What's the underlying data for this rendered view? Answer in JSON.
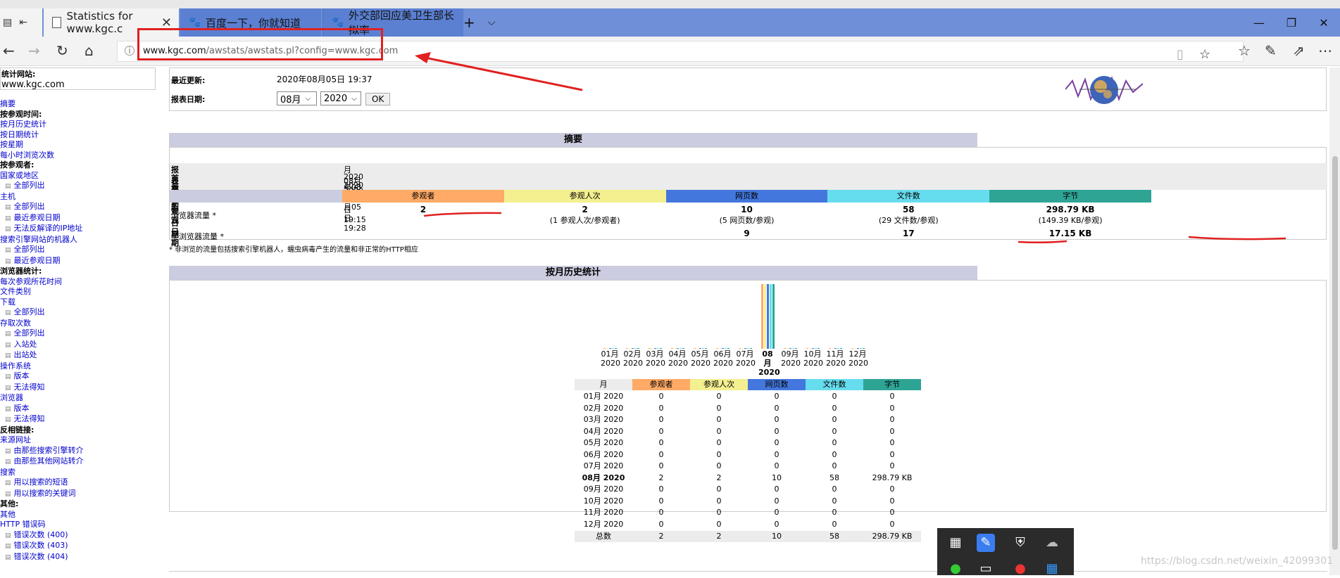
{
  "browser": {
    "tabs": [
      {
        "label": "Statistics for www.kgc.c",
        "active": true
      },
      {
        "label": "百度一下，你就知道",
        "active": false
      },
      {
        "label": "外交部回应美卫生部长拟率",
        "active": false
      }
    ],
    "address": {
      "host": "www.kgc.com",
      "path": "/awstats/awstats.pl?config=www.kgc.com"
    }
  },
  "sidebar": {
    "site_label": "统计网站:",
    "site_value": "www.kgc.com",
    "items": [
      {
        "t": "link",
        "label": "摘要"
      },
      {
        "t": "head",
        "label": "按参观时间:"
      },
      {
        "t": "link",
        "label": "按月历史统计"
      },
      {
        "t": "link",
        "label": "按日期统计"
      },
      {
        "t": "link",
        "label": "按星期"
      },
      {
        "t": "link",
        "label": "每小时浏览次数"
      },
      {
        "t": "head",
        "label": "按参观者:"
      },
      {
        "t": "link",
        "label": "国家或地区"
      },
      {
        "t": "sub",
        "label": "全部列出"
      },
      {
        "t": "link",
        "label": "主机"
      },
      {
        "t": "sub",
        "label": "全部列出"
      },
      {
        "t": "sub",
        "label": "最近参观日期"
      },
      {
        "t": "sub",
        "label": "无法反解译的IP地址"
      },
      {
        "t": "link",
        "label": "搜索引擎网站的机器人"
      },
      {
        "t": "sub",
        "label": "全部列出"
      },
      {
        "t": "sub",
        "label": "最近参观日期"
      },
      {
        "t": "head",
        "label": "浏览器统计:"
      },
      {
        "t": "link",
        "label": "每次参观所花时间"
      },
      {
        "t": "link",
        "label": "文件类别"
      },
      {
        "t": "link",
        "label": "下载"
      },
      {
        "t": "sub",
        "label": "全部列出"
      },
      {
        "t": "link",
        "label": "存取次数"
      },
      {
        "t": "sub",
        "label": "全部列出"
      },
      {
        "t": "sub",
        "label": "入站处"
      },
      {
        "t": "sub",
        "label": "出站处"
      },
      {
        "t": "link",
        "label": "操作系统"
      },
      {
        "t": "sub",
        "label": "版本"
      },
      {
        "t": "sub",
        "label": "无法得知"
      },
      {
        "t": "link",
        "label": "浏览器"
      },
      {
        "t": "sub",
        "label": "版本"
      },
      {
        "t": "sub",
        "label": "无法得知"
      },
      {
        "t": "head",
        "label": "反相链接:"
      },
      {
        "t": "link",
        "label": "来源网址"
      },
      {
        "t": "sub",
        "label": "由那些搜索引擎转介"
      },
      {
        "t": "sub",
        "label": "由那些其他网站转介"
      },
      {
        "t": "link",
        "label": "搜索"
      },
      {
        "t": "sub",
        "label": "用以搜索的短语"
      },
      {
        "t": "sub",
        "label": "用以搜索的关键词"
      },
      {
        "t": "head",
        "label": "其他:"
      },
      {
        "t": "link",
        "label": "其他"
      },
      {
        "t": "link",
        "label": "HTTP 错误码"
      },
      {
        "t": "sub",
        "label": "错误次数 (400)"
      },
      {
        "t": "sub",
        "label": "错误次数 (403)"
      },
      {
        "t": "sub",
        "label": "错误次数 (404)"
      }
    ]
  },
  "header": {
    "last_update_label": "最近更新:",
    "last_update_value": "2020年08月05日 19:37",
    "report_date_label": "报表日期:",
    "month_select": "08月",
    "year_select": "2020",
    "ok_label": "OK"
  },
  "summary": {
    "title": "摘要",
    "rows": [
      {
        "k": "报表日期",
        "v": "月 08月 2020"
      },
      {
        "k": "首次参观日期",
        "v": "2020年08月05日 19:15"
      },
      {
        "k": "最近参观日期",
        "v": "2020年08月05日 19:28"
      }
    ],
    "columns": [
      {
        "label": "参观者",
        "color": "#ffaa66"
      },
      {
        "label": "参观人次",
        "color": "#f4f090"
      },
      {
        "label": "网页数",
        "color": "#4477dd"
      },
      {
        "label": "文件数",
        "color": "#66ddee"
      },
      {
        "label": "字节",
        "color": "#2ea495"
      }
    ],
    "browser_label": "浏览器流量 *",
    "browser_values": [
      "2",
      "2",
      "10",
      "58",
      "298.79 KB"
    ],
    "browser_notes": [
      "",
      "(1 参观人次/参观者)",
      "(5 网页数/参观)",
      "(29 文件数/参观)",
      "(149.39 KB/参观)"
    ],
    "nonbrowser_label": "非浏览器流量 *",
    "nonbrowser_values": [
      "",
      "",
      "9",
      "17",
      "17.15 KB"
    ],
    "footnote": "* 非浏览的流量包括搜索引擎机器人，蠕虫病毒产生的流量和非正常的HTTP相应"
  },
  "monthly": {
    "title": "按月历史统计",
    "headers": [
      "月",
      "参观者",
      "参观人次",
      "网页数",
      "文件数",
      "字节"
    ],
    "rows": [
      [
        "01月 2020",
        "0",
        "0",
        "0",
        "0",
        "0"
      ],
      [
        "02月 2020",
        "0",
        "0",
        "0",
        "0",
        "0"
      ],
      [
        "03月 2020",
        "0",
        "0",
        "0",
        "0",
        "0"
      ],
      [
        "04月 2020",
        "0",
        "0",
        "0",
        "0",
        "0"
      ],
      [
        "05月 2020",
        "0",
        "0",
        "0",
        "0",
        "0"
      ],
      [
        "06月 2020",
        "0",
        "0",
        "0",
        "0",
        "0"
      ],
      [
        "07月 2020",
        "0",
        "0",
        "0",
        "0",
        "0"
      ],
      [
        "08月 2020",
        "2",
        "2",
        "10",
        "58",
        "298.79 KB"
      ],
      [
        "09月 2020",
        "0",
        "0",
        "0",
        "0",
        "0"
      ],
      [
        "10月 2020",
        "0",
        "0",
        "0",
        "0",
        "0"
      ],
      [
        "11月 2020",
        "0",
        "0",
        "0",
        "0",
        "0"
      ],
      [
        "12月 2020",
        "0",
        "0",
        "0",
        "0",
        "0"
      ]
    ],
    "total": [
      "总数",
      "2",
      "2",
      "10",
      "58",
      "298.79 KB"
    ],
    "chart_months": [
      "01月",
      "02月",
      "03月",
      "04月",
      "05月",
      "06月",
      "07月",
      "08月",
      "09月",
      "10月",
      "11月",
      "12月"
    ],
    "chart_year": "2020"
  },
  "watermark": "https://blog.csdn.net/weixin_42099301"
}
